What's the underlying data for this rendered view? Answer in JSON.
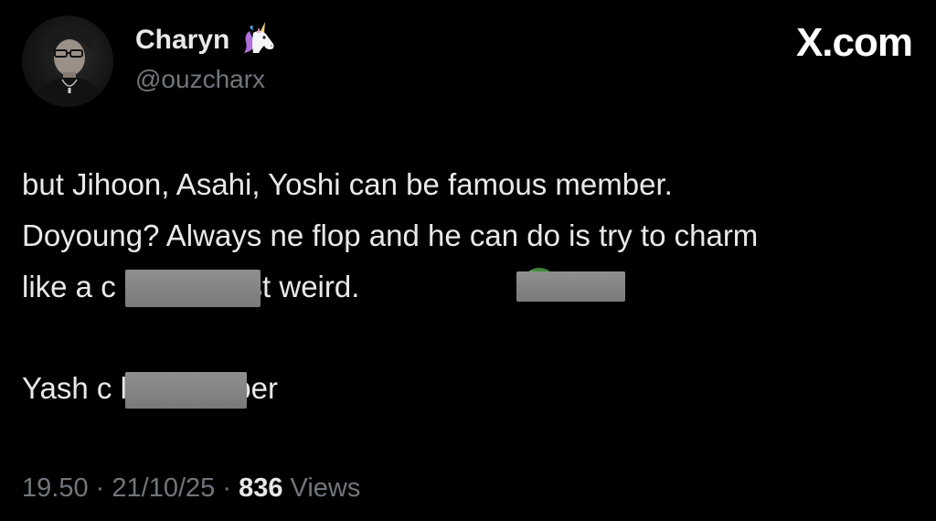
{
  "author": {
    "display_name": "Charyn",
    "handle": "@ouzcharx",
    "badge_icon": "unicorn-icon"
  },
  "site_mark": "X.com",
  "tweet": {
    "lines": [
      "but Jihoon, Asahi, Yoshi can be famous member.",
      "Doyoung? Always ne flop and he can do is try to charm",
      "like a c          lik . It's just weird.",
      "Yash c          lite member"
    ]
  },
  "meta": {
    "time": "19.50",
    "separator": "·",
    "date": "21/10/25",
    "view_count": "836",
    "views_label": "Views"
  },
  "colors": {
    "background": "#000000",
    "text": "#e7e9ea",
    "secondary": "#71767b",
    "redaction": "#808080"
  }
}
